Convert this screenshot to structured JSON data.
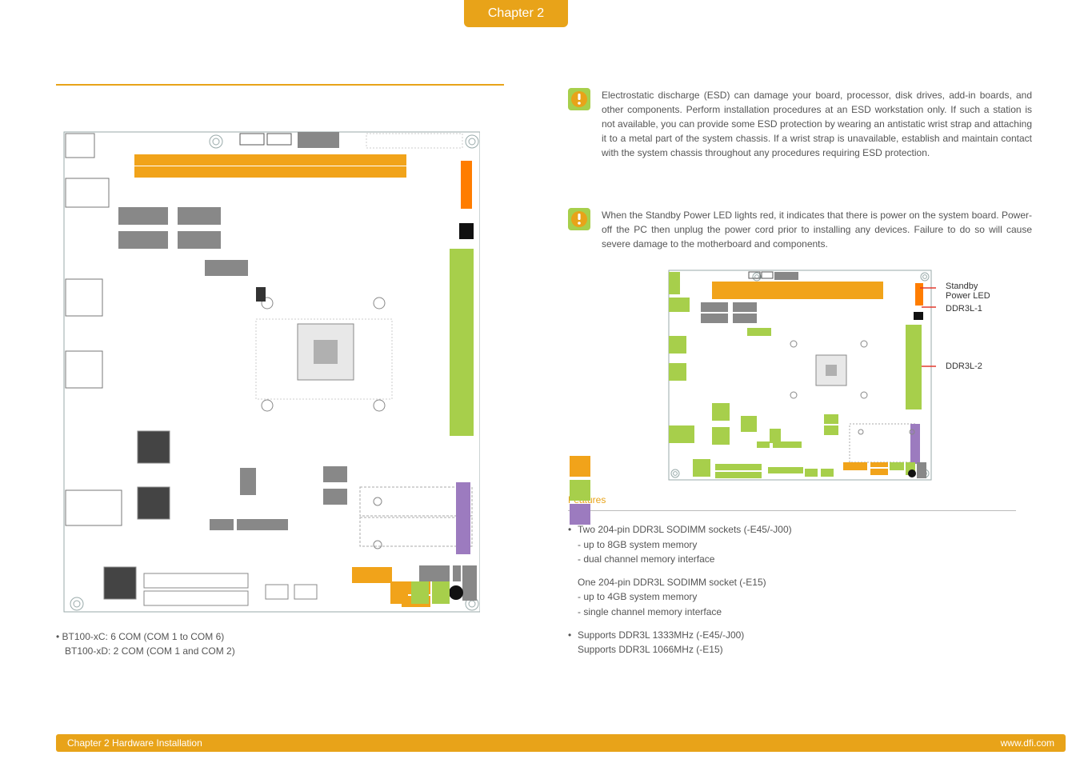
{
  "chapter_tab": "Chapter 2",
  "left": {
    "note_line1": "• BT100-xC: 6 COM (COM 1 to COM 6)",
    "note_line2": "BT100-xD: 2 COM (COM 1 and COM 2)"
  },
  "warnings": {
    "esd": "Electrostatic discharge (ESD) can damage your board, processor, disk drives, add-in boards, and other components. Perform installation procedures at an ESD workstation only. If such a station is not available, you can provide some ESD protection by wearing an antistatic wrist strap and attaching it to a metal part of the system chassis. If a wrist strap is unavailable, establish and maintain contact with the system chassis throughout any procedures requiring ESD protection.",
    "standby": "When the Standby Power LED lights red, it indicates that there is power on the system board. Power-off the PC then unplug the power cord prior to installing any devices. Failure to do so will cause severe damage to the motherboard and components."
  },
  "small_board_labels": {
    "standby_led": "Standby\nPower LED",
    "ddr1": "DDR3L-1",
    "ddr2": "DDR3L-2"
  },
  "features": {
    "heading": "Features",
    "b1": "Two 204-pin DDR3L SODIMM sockets (-E45/-J00)",
    "b1a": "- up to 8GB system memory",
    "b1b": "- dual channel memory interface",
    "b2": "One 204-pin DDR3L SODIMM socket (-E15)",
    "b2a": "- up to 4GB system memory",
    "b2b": "- single channel memory interface",
    "b3": "Supports DDR3L 1333MHz (-E45/-J00)",
    "b3a": "Supports DDR3L 1066MHz (-E15)"
  },
  "footer": {
    "left": "Chapter 2 Hardware Installation",
    "right": "www.dfi.com"
  }
}
